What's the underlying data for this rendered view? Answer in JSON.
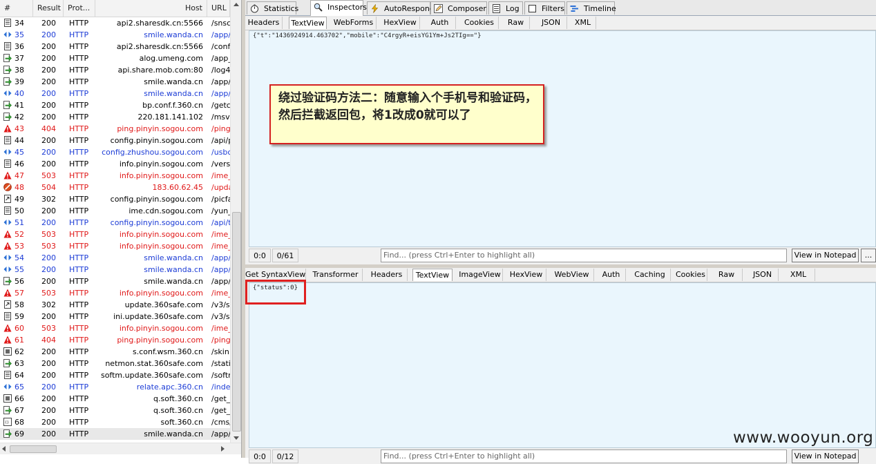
{
  "sessions": {
    "columns": [
      "#",
      "Result",
      "Prot...",
      "Host",
      "URL"
    ],
    "rows": [
      {
        "num": "34",
        "result": "200",
        "protocol": "HTTP",
        "host": "api2.sharesdk.cn:5566",
        "url": "/snsc",
        "icon": "document-icon",
        "color": "black"
      },
      {
        "num": "35",
        "result": "200",
        "protocol": "HTTP",
        "host": "smile.wanda.cn",
        "url": "/app/",
        "icon": "arrows-icon",
        "color": "blue"
      },
      {
        "num": "36",
        "result": "200",
        "protocol": "HTTP",
        "host": "api2.sharesdk.cn:5566",
        "url": "/conf",
        "icon": "document-icon",
        "color": "black"
      },
      {
        "num": "37",
        "result": "200",
        "protocol": "HTTP",
        "host": "alog.umeng.com",
        "url": "/app_",
        "icon": "arrow-icon",
        "color": "black"
      },
      {
        "num": "38",
        "result": "200",
        "protocol": "HTTP",
        "host": "api.share.mob.com:80",
        "url": "/log4",
        "icon": "arrow-icon",
        "color": "black"
      },
      {
        "num": "39",
        "result": "200",
        "protocol": "HTTP",
        "host": "smile.wanda.cn",
        "url": "/app/",
        "icon": "arrow-icon",
        "color": "black"
      },
      {
        "num": "40",
        "result": "200",
        "protocol": "HTTP",
        "host": "smile.wanda.cn",
        "url": "/app/",
        "icon": "arrows-icon",
        "color": "blue"
      },
      {
        "num": "41",
        "result": "200",
        "protocol": "HTTP",
        "host": "bp.conf.f.360.cn",
        "url": "/getc",
        "icon": "arrow-icon",
        "color": "black"
      },
      {
        "num": "42",
        "result": "200",
        "protocol": "HTTP",
        "host": "220.181.141.102",
        "url": "/msvc",
        "icon": "arrow-icon",
        "color": "black"
      },
      {
        "num": "43",
        "result": "404",
        "protocol": "HTTP",
        "host": "ping.pinyin.sogou.com",
        "url": "/pingl",
        "icon": "warning-icon",
        "color": "red"
      },
      {
        "num": "44",
        "result": "200",
        "protocol": "HTTP",
        "host": "config.pinyin.sogou.com",
        "url": "/api/p",
        "icon": "document-icon",
        "color": "black"
      },
      {
        "num": "45",
        "result": "200",
        "protocol": "HTTP",
        "host": "config.zhushou.sogou.com",
        "url": "/usbc",
        "icon": "arrows-icon",
        "color": "blue"
      },
      {
        "num": "46",
        "result": "200",
        "protocol": "HTTP",
        "host": "info.pinyin.sogou.com",
        "url": "/vers",
        "icon": "document-icon",
        "color": "black"
      },
      {
        "num": "47",
        "result": "503",
        "protocol": "HTTP",
        "host": "info.pinyin.sogou.com",
        "url": "/ime_",
        "icon": "warning-icon",
        "color": "red"
      },
      {
        "num": "48",
        "result": "504",
        "protocol": "HTTP",
        "host": "183.60.62.45",
        "url": "/upda",
        "icon": "blocked-icon",
        "color": "red"
      },
      {
        "num": "49",
        "result": "302",
        "protocol": "HTTP",
        "host": "config.pinyin.sogou.com",
        "url": "/picfa",
        "icon": "redirect-icon",
        "color": "black"
      },
      {
        "num": "50",
        "result": "200",
        "protocol": "HTTP",
        "host": "ime.cdn.sogou.com",
        "url": "/yun_",
        "icon": "document-icon",
        "color": "black"
      },
      {
        "num": "51",
        "result": "200",
        "protocol": "HTTP",
        "host": "config.pinyin.sogou.com",
        "url": "/api/t",
        "icon": "arrows-icon",
        "color": "blue"
      },
      {
        "num": "52",
        "result": "503",
        "protocol": "HTTP",
        "host": "info.pinyin.sogou.com",
        "url": "/ime_",
        "icon": "warning-icon",
        "color": "red"
      },
      {
        "num": "53",
        "result": "503",
        "protocol": "HTTP",
        "host": "info.pinyin.sogou.com",
        "url": "/ime_",
        "icon": "warning-icon",
        "color": "red"
      },
      {
        "num": "54",
        "result": "200",
        "protocol": "HTTP",
        "host": "smile.wanda.cn",
        "url": "/app/",
        "icon": "arrows-icon",
        "color": "blue"
      },
      {
        "num": "55",
        "result": "200",
        "protocol": "HTTP",
        "host": "smile.wanda.cn",
        "url": "/app/",
        "icon": "arrows-icon",
        "color": "blue"
      },
      {
        "num": "56",
        "result": "200",
        "protocol": "HTTP",
        "host": "smile.wanda.cn",
        "url": "/app/",
        "icon": "arrow-icon",
        "color": "black"
      },
      {
        "num": "57",
        "result": "503",
        "protocol": "HTTP",
        "host": "info.pinyin.sogou.com",
        "url": "/ime_",
        "icon": "warning-icon",
        "color": "red"
      },
      {
        "num": "58",
        "result": "302",
        "protocol": "HTTP",
        "host": "update.360safe.com",
        "url": "/v3/s",
        "icon": "redirect-icon",
        "color": "black"
      },
      {
        "num": "59",
        "result": "200",
        "protocol": "HTTP",
        "host": "ini.update.360safe.com",
        "url": "/v3/s",
        "icon": "document-icon",
        "color": "black"
      },
      {
        "num": "60",
        "result": "503",
        "protocol": "HTTP",
        "host": "info.pinyin.sogou.com",
        "url": "/ime_",
        "icon": "warning-icon",
        "color": "red"
      },
      {
        "num": "61",
        "result": "404",
        "protocol": "HTTP",
        "host": "ping.pinyin.sogou.com",
        "url": "/pingl",
        "icon": "warning-icon",
        "color": "red"
      },
      {
        "num": "62",
        "result": "200",
        "protocol": "HTTP",
        "host": "s.conf.wsm.360.cn",
        "url": "/skin.",
        "icon": "binary-icon",
        "color": "black"
      },
      {
        "num": "63",
        "result": "200",
        "protocol": "HTTP",
        "host": "netmon.stat.360safe.com",
        "url": "/stati",
        "icon": "arrow-icon",
        "color": "black"
      },
      {
        "num": "64",
        "result": "200",
        "protocol": "HTTP",
        "host": "softm.update.360safe.com",
        "url": "/softr",
        "icon": "document-icon",
        "color": "black"
      },
      {
        "num": "65",
        "result": "200",
        "protocol": "HTTP",
        "host": "relate.apc.360.cn",
        "url": "/index",
        "icon": "arrows-icon",
        "color": "blue"
      },
      {
        "num": "66",
        "result": "200",
        "protocol": "HTTP",
        "host": "q.soft.360.cn",
        "url": "/get_",
        "icon": "binary-icon",
        "color": "black"
      },
      {
        "num": "67",
        "result": "200",
        "protocol": "HTTP",
        "host": "q.soft.360.cn",
        "url": "/get_",
        "icon": "arrow-icon",
        "color": "black"
      },
      {
        "num": "68",
        "result": "200",
        "protocol": "HTTP",
        "host": "soft.360.cn",
        "url": "/cms/",
        "icon": "json-icon",
        "color": "black"
      },
      {
        "num": "69",
        "result": "200",
        "protocol": "HTTP",
        "host": "smile.wanda.cn",
        "url": "/app/",
        "icon": "arrow-icon",
        "color": "black",
        "selected": true
      }
    ]
  },
  "main_tabs": [
    {
      "label": "Statistics",
      "icon": "stopwatch-icon"
    },
    {
      "label": "Inspectors",
      "icon": "magnifier-icon",
      "active": true
    },
    {
      "label": "AutoResponder",
      "icon": "lightning-icon"
    },
    {
      "label": "Composer",
      "icon": "pencil-icon"
    },
    {
      "label": "Log",
      "icon": "log-icon"
    },
    {
      "label": "Filters",
      "icon": "checkbox-icon"
    },
    {
      "label": "Timeline",
      "icon": "timeline-icon"
    }
  ],
  "request": {
    "tabs": [
      "Headers",
      "TextView",
      "WebForms",
      "HexView",
      "Auth",
      "Cookies",
      "Raw",
      "JSON",
      "XML"
    ],
    "active_tab": "TextView",
    "body": "{\"t\":\"1436924914.463702\",\"mobile\":\"C4rgyR+eisYG1Ym+Js2TIg==\"}",
    "status": {
      "position": "0:0",
      "count": "0/61",
      "find_placeholder": "Find... (press Ctrl+Enter to highlight all)",
      "notepad_button": "View in Notepad",
      "more_button": "..."
    }
  },
  "response": {
    "tabs": [
      "Get SyntaxView",
      "Transformer",
      "Headers",
      "TextView",
      "ImageView",
      "HexView",
      "WebView",
      "Auth",
      "Caching",
      "Cookies",
      "Raw",
      "JSON",
      "XML"
    ],
    "active_tab": "TextView",
    "body": "{\"status\":0}",
    "status": {
      "position": "0:0",
      "count": "0/12",
      "find_placeholder": "Find... (press Ctrl+Enter to highlight all)",
      "notepad_button": "View in Notepad"
    }
  },
  "annotation": {
    "text": "绕过验证码方法二：随意输入个手机号和验证码，然后拦截返回包，将1改成0就可以了"
  },
  "watermark": "www.wooyun.org",
  "colors": {
    "error": "#e01818",
    "blue": "#1c3cd6",
    "callout_bg": "#ffffcc",
    "callout_border": "#d42020"
  }
}
